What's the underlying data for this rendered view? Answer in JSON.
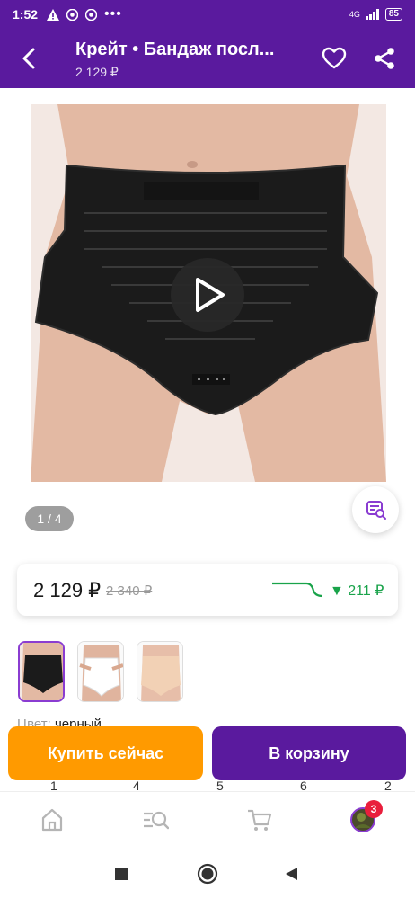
{
  "status_bar": {
    "time": "1:52",
    "network": "4G",
    "battery": "85"
  },
  "header": {
    "title": "Крейт • Бандаж посл...",
    "price": "2 129 ₽"
  },
  "gallery": {
    "counter": "1 / 4"
  },
  "price": {
    "current": "2 129 ₽",
    "old": "2 340 ₽",
    "drop": "▼ 211 ₽",
    "drop_color": "#19a34a"
  },
  "color": {
    "label": "Цвет:",
    "value": "черный"
  },
  "buttons": {
    "buy_now": "Купить сейчас",
    "add_to_cart": "В корзину"
  },
  "sizes": [
    "1",
    "4",
    "5",
    "6",
    "2"
  ],
  "bottom_nav": {
    "items": [
      "home-icon",
      "catalog-search-icon",
      "cart-icon",
      "profile-icon"
    ],
    "badge": "3"
  },
  "colors": {
    "brand": "#5a1a9e",
    "buy": "#ff9a00",
    "badge": "#e91e3c"
  }
}
